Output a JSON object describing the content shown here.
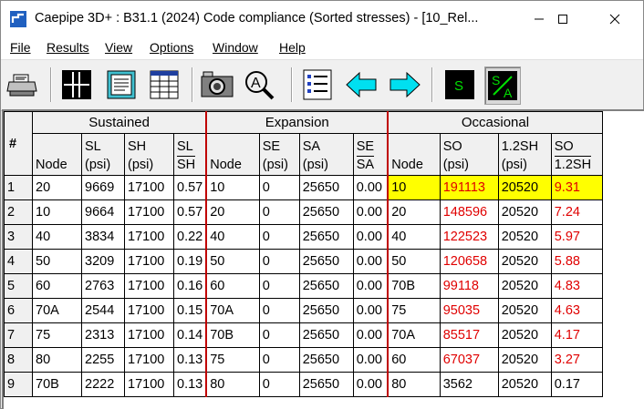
{
  "window": {
    "title": "Caepipe 3D+ : B31.1 (2024) Code compliance (Sorted stresses) -  [10_Rel..."
  },
  "menu": [
    {
      "label": "File"
    },
    {
      "label": "Results"
    },
    {
      "label": "View"
    },
    {
      "label": "Options"
    },
    {
      "label": "Window"
    },
    {
      "label": "Help"
    }
  ],
  "toolbar": {
    "s_label": "S",
    "sa_top": "S",
    "sa_bottom": "A",
    "colors": {
      "arrow": "#00e0f0",
      "s_button_bg": "#000000",
      "s_button_text": "#00e000"
    }
  },
  "table": {
    "row_header": "#",
    "groups": [
      "Sustained",
      "Expansion",
      "Occasional"
    ],
    "columns": {
      "node": "Node",
      "sl": [
        "SL",
        "(psi)"
      ],
      "sh": [
        "SH",
        "(psi)"
      ],
      "sl_sh": [
        "SL",
        "SH"
      ],
      "se": [
        "SE",
        "(psi)"
      ],
      "sa": [
        "SA",
        "(psi)"
      ],
      "se_sa": [
        "SE",
        "SA"
      ],
      "so": [
        "SO",
        "(psi)"
      ],
      "sh12": [
        "1.2SH",
        "(psi)"
      ],
      "so_sh": [
        "SO",
        "1.2SH"
      ]
    },
    "rows": [
      {
        "n": "1",
        "sn": "20",
        "sl": "9669",
        "sh": "17100",
        "r1": "0.57",
        "en": "10",
        "se": "0",
        "sa": "25650",
        "r2": "0.00",
        "on": "10",
        "so": "191113",
        "sh12": "20520",
        "r3": "9.31",
        "so_red": true,
        "highlight": true
      },
      {
        "n": "2",
        "sn": "10",
        "sl": "9664",
        "sh": "17100",
        "r1": "0.57",
        "en": "20",
        "se": "0",
        "sa": "25650",
        "r2": "0.00",
        "on": "20",
        "so": "148596",
        "sh12": "20520",
        "r3": "7.24",
        "so_red": true,
        "highlight": false
      },
      {
        "n": "3",
        "sn": "40",
        "sl": "3834",
        "sh": "17100",
        "r1": "0.22",
        "en": "40",
        "se": "0",
        "sa": "25650",
        "r2": "0.00",
        "on": "40",
        "so": "122523",
        "sh12": "20520",
        "r3": "5.97",
        "so_red": true,
        "highlight": false
      },
      {
        "n": "4",
        "sn": "50",
        "sl": "3209",
        "sh": "17100",
        "r1": "0.19",
        "en": "50",
        "se": "0",
        "sa": "25650",
        "r2": "0.00",
        "on": "50",
        "so": "120658",
        "sh12": "20520",
        "r3": "5.88",
        "so_red": true,
        "highlight": false
      },
      {
        "n": "5",
        "sn": "60",
        "sl": "2763",
        "sh": "17100",
        "r1": "0.16",
        "en": "60",
        "se": "0",
        "sa": "25650",
        "r2": "0.00",
        "on": "70B",
        "so": "99118",
        "sh12": "20520",
        "r3": "4.83",
        "so_red": true,
        "highlight": false
      },
      {
        "n": "6",
        "sn": "70A",
        "sl": "2544",
        "sh": "17100",
        "r1": "0.15",
        "en": "70A",
        "se": "0",
        "sa": "25650",
        "r2": "0.00",
        "on": "75",
        "so": "95035",
        "sh12": "20520",
        "r3": "4.63",
        "so_red": true,
        "highlight": false
      },
      {
        "n": "7",
        "sn": "75",
        "sl": "2313",
        "sh": "17100",
        "r1": "0.14",
        "en": "70B",
        "se": "0",
        "sa": "25650",
        "r2": "0.00",
        "on": "70A",
        "so": "85517",
        "sh12": "20520",
        "r3": "4.17",
        "so_red": true,
        "highlight": false
      },
      {
        "n": "8",
        "sn": "80",
        "sl": "2255",
        "sh": "17100",
        "r1": "0.13",
        "en": "75",
        "se": "0",
        "sa": "25650",
        "r2": "0.00",
        "on": "60",
        "so": "67037",
        "sh12": "20520",
        "r3": "3.27",
        "so_red": true,
        "highlight": false
      },
      {
        "n": "9",
        "sn": "70B",
        "sl": "2222",
        "sh": "17100",
        "r1": "0.13",
        "en": "80",
        "se": "0",
        "sa": "25650",
        "r2": "0.00",
        "on": "80",
        "so": "3562",
        "sh12": "20520",
        "r3": "0.17",
        "so_red": false,
        "highlight": false
      }
    ]
  }
}
